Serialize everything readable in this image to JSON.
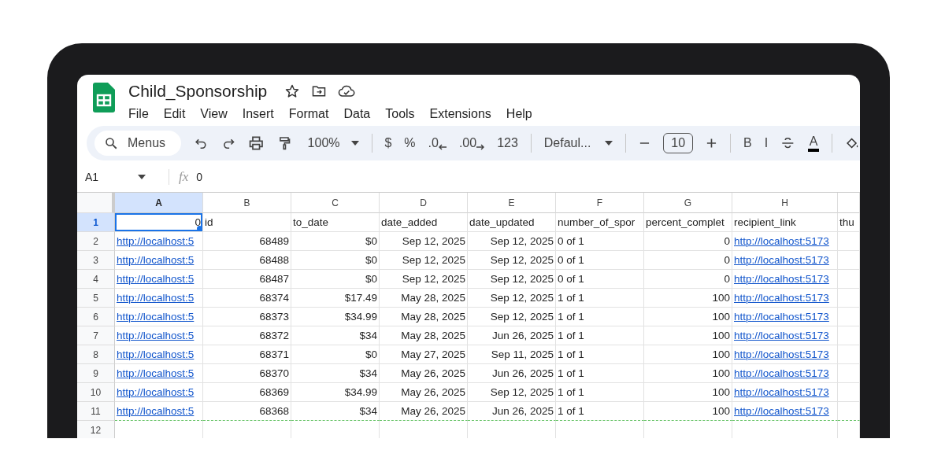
{
  "document": {
    "title": "Child_Sponsorship"
  },
  "menus": [
    "File",
    "Edit",
    "View",
    "Insert",
    "Format",
    "Data",
    "Tools",
    "Extensions",
    "Help"
  ],
  "toolbar": {
    "search_label": "Menus",
    "zoom": "100%",
    "currency": "$",
    "percent": "%",
    "decrease_decimal": ".0",
    "increase_decimal": ".00",
    "number_format": "123",
    "font": "Defaul...",
    "font_size": "10",
    "bold": "B",
    "italic": "I",
    "text_color": "A"
  },
  "formula_bar": {
    "cell_reference": "A1",
    "function_label": "fx",
    "value": "0"
  },
  "columns": [
    {
      "letter": "A",
      "selected": true
    },
    {
      "letter": "B",
      "selected": false
    },
    {
      "letter": "C",
      "selected": false
    },
    {
      "letter": "D",
      "selected": false
    },
    {
      "letter": "E",
      "selected": false
    },
    {
      "letter": "F",
      "selected": false
    },
    {
      "letter": "G",
      "selected": false
    },
    {
      "letter": "H",
      "selected": false
    },
    {
      "selected": false
    }
  ],
  "rows": [
    {
      "number": "1",
      "selected": true,
      "cells": [
        {
          "text": "0",
          "kind": "number"
        },
        {
          "text": "id",
          "kind": "text"
        },
        {
          "text": "to_date",
          "kind": "text"
        },
        {
          "text": "date_added",
          "kind": "text"
        },
        {
          "text": "date_updated",
          "kind": "text"
        },
        {
          "text": "number_of_spor",
          "kind": "text"
        },
        {
          "text": "percent_complet",
          "kind": "text"
        },
        {
          "text": "recipient_link",
          "kind": "text"
        },
        {
          "text": "thu",
          "kind": "text"
        }
      ]
    },
    {
      "number": "2",
      "selected": false,
      "cells": [
        {
          "text": "http://localhost:5",
          "kind": "link"
        },
        {
          "text": "68489",
          "kind": "number"
        },
        {
          "text": "$0",
          "kind": "number"
        },
        {
          "text": "Sep 12, 2025",
          "kind": "number"
        },
        {
          "text": "Sep 12, 2025",
          "kind": "number"
        },
        {
          "text": "0 of 1",
          "kind": "text"
        },
        {
          "text": "0",
          "kind": "number"
        },
        {
          "text": "http://localhost:5173",
          "kind": "link"
        }
      ]
    },
    {
      "number": "3",
      "selected": false,
      "cells": [
        {
          "text": "http://localhost:5",
          "kind": "link"
        },
        {
          "text": "68488",
          "kind": "number"
        },
        {
          "text": "$0",
          "kind": "number"
        },
        {
          "text": "Sep 12, 2025",
          "kind": "number"
        },
        {
          "text": "Sep 12, 2025",
          "kind": "number"
        },
        {
          "text": "0 of 1",
          "kind": "text"
        },
        {
          "text": "0",
          "kind": "number"
        },
        {
          "text": "http://localhost:5173",
          "kind": "link"
        }
      ]
    },
    {
      "number": "4",
      "selected": false,
      "cells": [
        {
          "text": "http://localhost:5",
          "kind": "link"
        },
        {
          "text": "68487",
          "kind": "number"
        },
        {
          "text": "$0",
          "kind": "number"
        },
        {
          "text": "Sep 12, 2025",
          "kind": "number"
        },
        {
          "text": "Sep 12, 2025",
          "kind": "number"
        },
        {
          "text": "0 of 1",
          "kind": "text"
        },
        {
          "text": "0",
          "kind": "number"
        },
        {
          "text": "http://localhost:5173",
          "kind": "link"
        }
      ]
    },
    {
      "number": "5",
      "selected": false,
      "cells": [
        {
          "text": "http://localhost:5",
          "kind": "link"
        },
        {
          "text": "68374",
          "kind": "number"
        },
        {
          "text": "$17.49",
          "kind": "number"
        },
        {
          "text": "May 28, 2025",
          "kind": "number"
        },
        {
          "text": "Sep 12, 2025",
          "kind": "number"
        },
        {
          "text": "1 of 1",
          "kind": "text"
        },
        {
          "text": "100",
          "kind": "number"
        },
        {
          "text": "http://localhost:5173",
          "kind": "link"
        }
      ]
    },
    {
      "number": "6",
      "selected": false,
      "cells": [
        {
          "text": "http://localhost:5",
          "kind": "link"
        },
        {
          "text": "68373",
          "kind": "number"
        },
        {
          "text": "$34.99",
          "kind": "number"
        },
        {
          "text": "May 28, 2025",
          "kind": "number"
        },
        {
          "text": "Sep 12, 2025",
          "kind": "number"
        },
        {
          "text": "1 of 1",
          "kind": "text"
        },
        {
          "text": "100",
          "kind": "number"
        },
        {
          "text": "http://localhost:5173",
          "kind": "link"
        }
      ]
    },
    {
      "number": "7",
      "selected": false,
      "cells": [
        {
          "text": "http://localhost:5",
          "kind": "link"
        },
        {
          "text": "68372",
          "kind": "number"
        },
        {
          "text": "$34",
          "kind": "number"
        },
        {
          "text": "May 28, 2025",
          "kind": "number"
        },
        {
          "text": "Jun 26, 2025",
          "kind": "number"
        },
        {
          "text": "1 of 1",
          "kind": "text"
        },
        {
          "text": "100",
          "kind": "number"
        },
        {
          "text": "http://localhost:5173",
          "kind": "link"
        }
      ]
    },
    {
      "number": "8",
      "selected": false,
      "cells": [
        {
          "text": "http://localhost:5",
          "kind": "link"
        },
        {
          "text": "68371",
          "kind": "number"
        },
        {
          "text": "$0",
          "kind": "number"
        },
        {
          "text": "May 27, 2025",
          "kind": "number"
        },
        {
          "text": "Sep 11, 2025",
          "kind": "number"
        },
        {
          "text": "1 of 1",
          "kind": "text"
        },
        {
          "text": "100",
          "kind": "number"
        },
        {
          "text": "http://localhost:5173",
          "kind": "link"
        }
      ]
    },
    {
      "number": "9",
      "selected": false,
      "cells": [
        {
          "text": "http://localhost:5",
          "kind": "link"
        },
        {
          "text": "68370",
          "kind": "number"
        },
        {
          "text": "$34",
          "kind": "number"
        },
        {
          "text": "May 26, 2025",
          "kind": "number"
        },
        {
          "text": "Jun 26, 2025",
          "kind": "number"
        },
        {
          "text": "1 of 1",
          "kind": "text"
        },
        {
          "text": "100",
          "kind": "number"
        },
        {
          "text": "http://localhost:5173",
          "kind": "link"
        }
      ]
    },
    {
      "number": "10",
      "selected": false,
      "cells": [
        {
          "text": "http://localhost:5",
          "kind": "link"
        },
        {
          "text": "68369",
          "kind": "number"
        },
        {
          "text": "$34.99",
          "kind": "number"
        },
        {
          "text": "May 26, 2025",
          "kind": "number"
        },
        {
          "text": "Sep 12, 2025",
          "kind": "number"
        },
        {
          "text": "1 of 1",
          "kind": "text"
        },
        {
          "text": "100",
          "kind": "number"
        },
        {
          "text": "http://localhost:5173",
          "kind": "link"
        }
      ]
    },
    {
      "number": "11",
      "selected": false,
      "cells": [
        {
          "text": "http://localhost:5",
          "kind": "link"
        },
        {
          "text": "68368",
          "kind": "number"
        },
        {
          "text": "$34",
          "kind": "number"
        },
        {
          "text": "May 26, 2025",
          "kind": "number"
        },
        {
          "text": "Jun 26, 2025",
          "kind": "number"
        },
        {
          "text": "1 of 1",
          "kind": "text"
        },
        {
          "text": "100",
          "kind": "number"
        },
        {
          "text": "http://localhost:5173",
          "kind": "link"
        }
      ]
    },
    {
      "number": "12",
      "selected": false
    }
  ]
}
